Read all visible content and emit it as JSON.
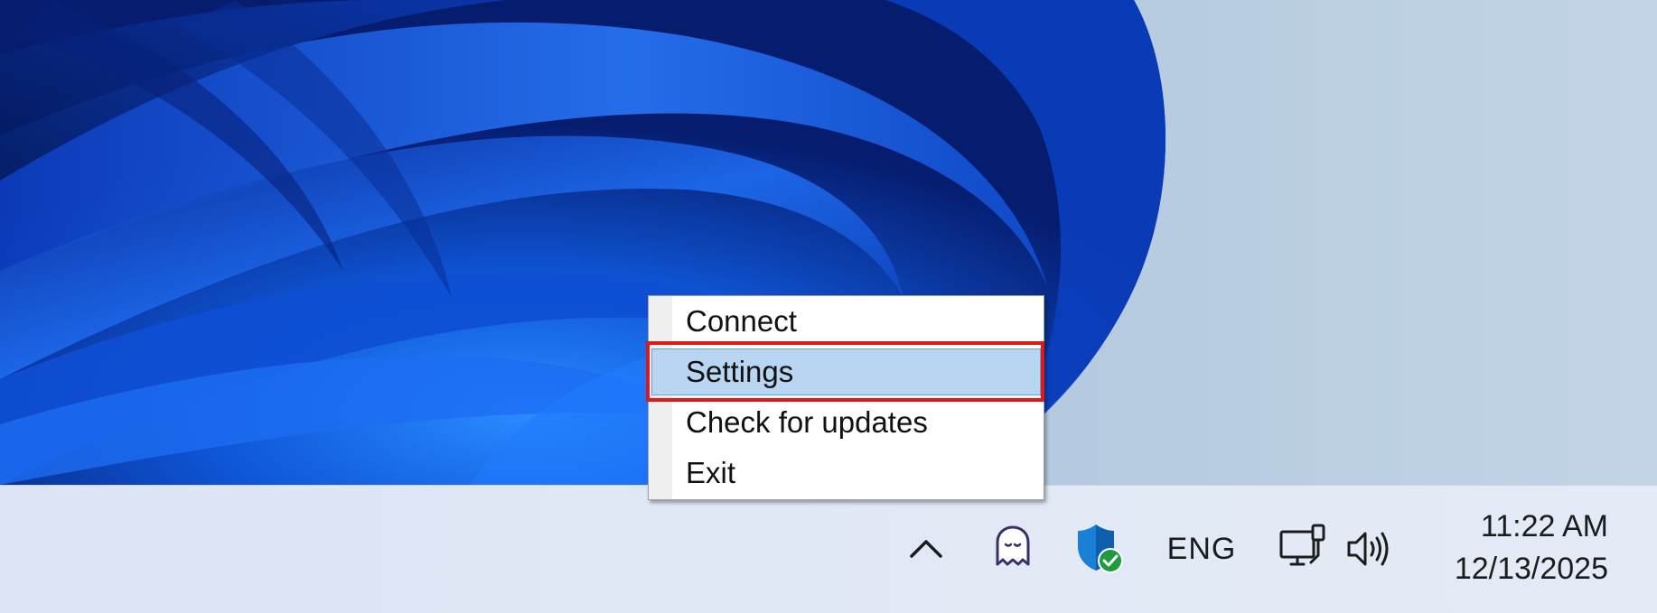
{
  "context_menu": {
    "items": [
      {
        "label": "Connect",
        "highlighted": false
      },
      {
        "label": "Settings",
        "highlighted": true
      },
      {
        "label": "Check for updates",
        "highlighted": false
      },
      {
        "label": "Exit",
        "highlighted": false
      }
    ],
    "highlight_color": "#b8d6f1",
    "focus_outline_color": "#e01818"
  },
  "taskbar": {
    "tray": {
      "overflow_icon": "chevron-up-icon",
      "app_icon": "ghost-icon",
      "security_icon": "shield-check-icon",
      "language": "ENG",
      "network_icon": "wired-network-icon",
      "volume_icon": "speaker-icon"
    },
    "clock": {
      "time": "11:22 AM",
      "date": "12/13/2025"
    }
  },
  "colors": {
    "wallpaper_accent": "#1560e8",
    "taskbar_bg": "#e1e8f5",
    "shield_blue": "#1a7fd6",
    "check_green": "#1e9b3f"
  }
}
